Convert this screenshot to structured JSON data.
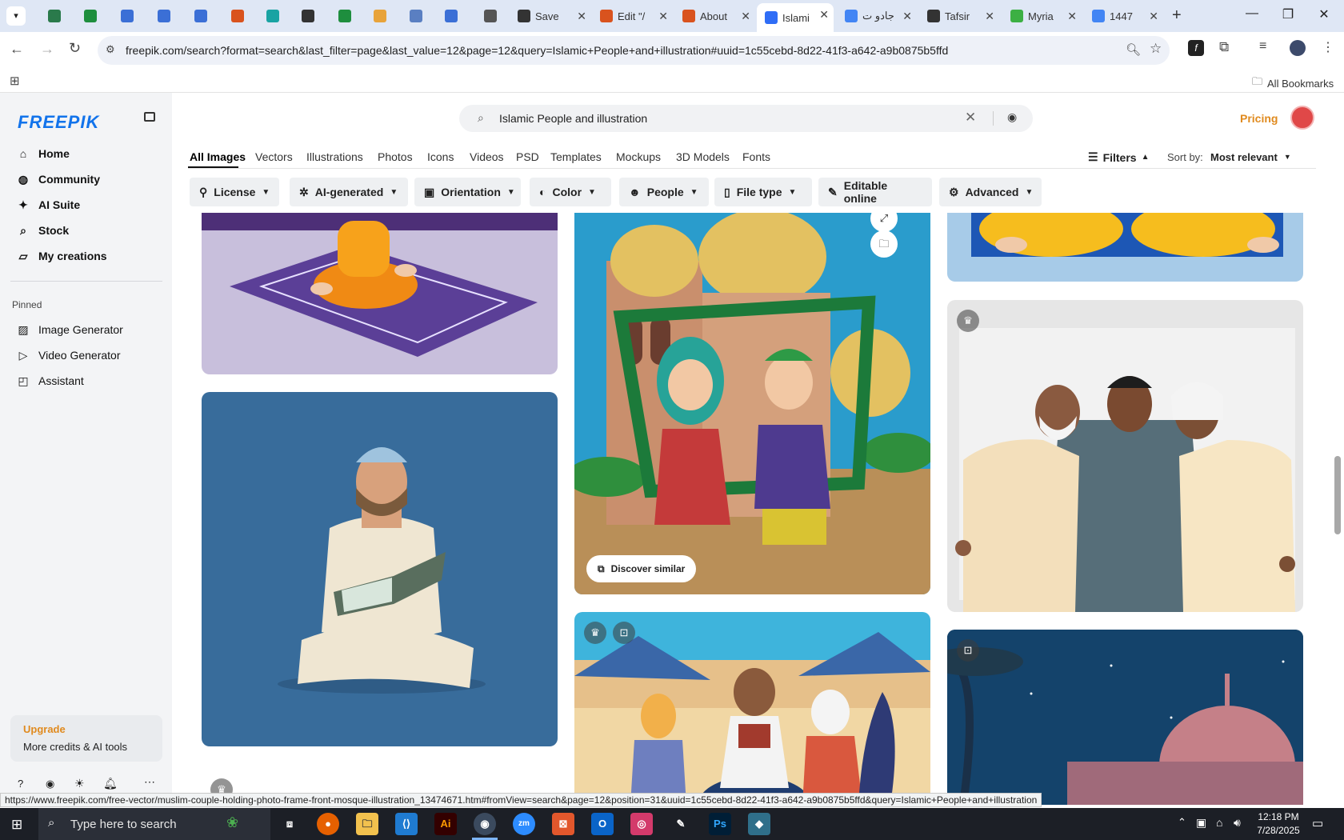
{
  "browser": {
    "tabs": [
      {
        "label": "",
        "color": "#2a7a4b"
      },
      {
        "label": "",
        "color": "#1e8e3e"
      },
      {
        "label": "",
        "color": "#3b6fd6"
      },
      {
        "label": "",
        "color": "#3b6fd6"
      },
      {
        "label": "",
        "color": "#3b6fd6"
      },
      {
        "label": "",
        "color": "#d9531e"
      },
      {
        "label": "",
        "color": "#19a3a3"
      },
      {
        "label": "",
        "color": "#333333"
      },
      {
        "label": "",
        "color": "#1e8e3e"
      },
      {
        "label": "",
        "color": "#e8a33a"
      },
      {
        "label": "",
        "color": "#5a7fc2"
      },
      {
        "label": "",
        "color": "#3b6fd6"
      },
      {
        "label": "",
        "color": "#555555"
      },
      {
        "label": "Save",
        "color": "#333333"
      },
      {
        "label": "Edit \"/",
        "color": "#d9531e"
      },
      {
        "label": "About",
        "color": "#d9531e"
      },
      {
        "label": "Islami",
        "color": "#2f6df6"
      },
      {
        "label": "جادو ت",
        "color": "#4285f4"
      },
      {
        "label": "Tafsir",
        "color": "#333333"
      },
      {
        "label": "Myria",
        "color": "#3cb043"
      },
      {
        "label": "1447",
        "color": "#4285f4"
      }
    ],
    "url": "freepik.com/search?format=search&last_filter=page&last_value=12&page=12&query=Islamic+People+and+illustration#uuid=1c55cebd-8d22-41f3-a642-a9b0875b5ffd",
    "all_bookmarks_label": "All Bookmarks"
  },
  "brand": {
    "logo": "FREEPIK",
    "accent": "#1273eb"
  },
  "sidebar": {
    "items": [
      {
        "label": "Home",
        "icon": "home-icon"
      },
      {
        "label": "Community",
        "icon": "globe-icon"
      },
      {
        "label": "AI Suite",
        "icon": "sparkle-icon"
      },
      {
        "label": "Stock",
        "icon": "search-icon"
      },
      {
        "label": "My creations",
        "icon": "folder-icon"
      }
    ],
    "pinned_label": "Pinned",
    "pinned": [
      {
        "label": "Image Generator",
        "icon": "image-icon"
      },
      {
        "label": "Video Generator",
        "icon": "video-icon"
      },
      {
        "label": "Assistant",
        "icon": "assistant-icon"
      }
    ],
    "upgrade": {
      "title": "Upgrade",
      "subtitle": "More credits & AI tools"
    }
  },
  "search": {
    "value": "Islamic People and illustration"
  },
  "header": {
    "pricing": "Pricing"
  },
  "nav_tabs": [
    "All Images",
    "Vectors",
    "Illustrations",
    "Photos",
    "Icons",
    "Videos",
    "PSD",
    "Templates",
    "Mockups",
    "3D Models",
    "Fonts"
  ],
  "filters": {
    "label": "Filters",
    "sort_label": "Sort by:",
    "sort_value": "Most relevant"
  },
  "chips": [
    "License",
    "AI-generated",
    "Orientation",
    "Color",
    "People",
    "File type",
    "Editable online",
    "Advanced"
  ],
  "cards": {
    "discover_similar": "Discover similar"
  },
  "status_url": "https://www.freepik.com/free-vector/muslim-couple-holding-photo-frame-front-mosque-illustration_13474671.htm#fromView=search&page=12&position=31&uuid=1c55cebd-8d22-41f3-a642-a9b0875b5ffd&query=Islamic+People+and+illustration",
  "taskbar": {
    "search_placeholder": "Type here to search",
    "time": "12:18 PM",
    "date": "7/28/2025"
  }
}
